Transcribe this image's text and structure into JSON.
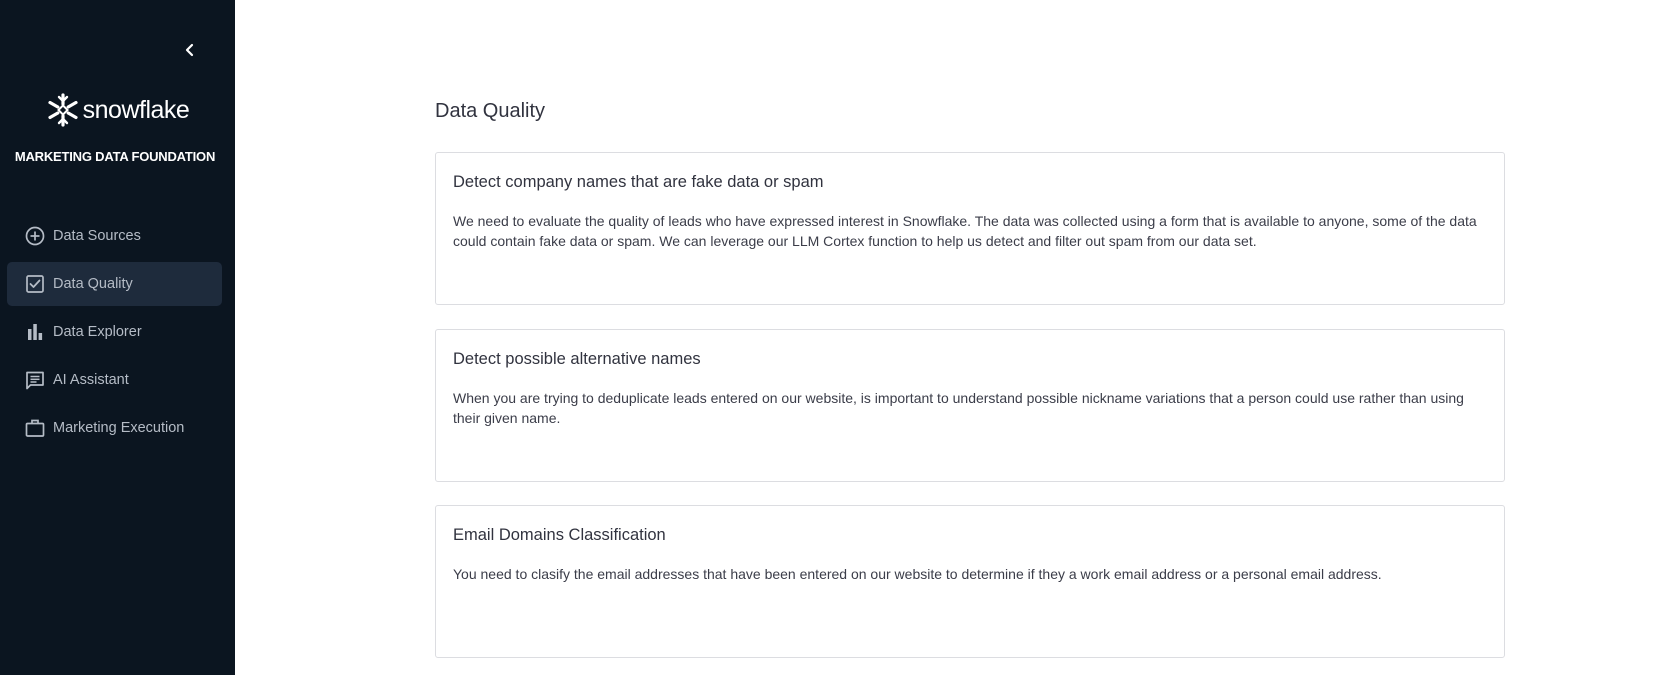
{
  "sidebar": {
    "brand": "snowflake",
    "subtitle": "MARKETING DATA FOUNDATION",
    "items": [
      {
        "label": "Data Sources",
        "icon": "plus-circle-icon",
        "active": false
      },
      {
        "label": "Data Quality",
        "icon": "checkbox-icon",
        "active": true
      },
      {
        "label": "Data Explorer",
        "icon": "bar-chart-icon",
        "active": false
      },
      {
        "label": "AI Assistant",
        "icon": "chat-icon",
        "active": false
      },
      {
        "label": "Marketing Execution",
        "icon": "briefcase-icon",
        "active": false
      }
    ]
  },
  "main": {
    "title": "Data Quality",
    "cards": [
      {
        "title": "Detect company names that are fake data or spam",
        "description": "We need to evaluate the quality of leads who have expressed interest in Snowflake. The data was collected using a form that is available to anyone, some of the data could contain fake data or spam. We can leverage our LLM Cortex function to help us detect and filter out spam from our data set."
      },
      {
        "title": "Detect possible alternative names",
        "description": "When you are trying to deduplicate leads entered on our website, is important to understand possible nickname variations that a person could use rather than using their given name."
      },
      {
        "title": "Email Domains Classification",
        "description": "You need to clasify the email addresses that have been entered on our website to determine if they a work email address or a personal email address."
      }
    ]
  },
  "colors": {
    "sidebar_bg": "#0b1520",
    "active_item_bg": "#1e2b3c",
    "nav_text": "#b5bcc6",
    "card_border": "#dcdde1"
  }
}
